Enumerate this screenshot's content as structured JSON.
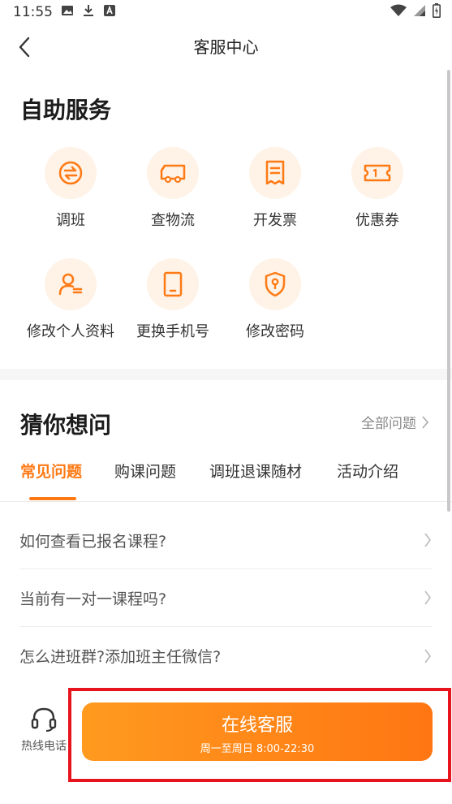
{
  "status_bar": {
    "time": "11:55"
  },
  "nav": {
    "title": "客服中心"
  },
  "self_service": {
    "title": "自助服务",
    "items": [
      {
        "label": "调班",
        "icon": "swap-icon"
      },
      {
        "label": "查物流",
        "icon": "truck-icon"
      },
      {
        "label": "开发票",
        "icon": "receipt-icon"
      },
      {
        "label": "优惠券",
        "icon": "coupon-icon"
      },
      {
        "label": "修改个人资料",
        "icon": "profile-edit-icon"
      },
      {
        "label": "更换手机号",
        "icon": "phone-icon"
      },
      {
        "label": "修改密码",
        "icon": "shield-lock-icon"
      }
    ]
  },
  "faq": {
    "title": "猜你想问",
    "see_all": "全部问题",
    "tabs": [
      {
        "label": "常见问题",
        "active": true
      },
      {
        "label": "购课问题",
        "active": false
      },
      {
        "label": "调班退课随材",
        "active": false
      },
      {
        "label": "活动介绍",
        "active": false
      }
    ],
    "questions": [
      "如何查看已报名课程?",
      "当前有一对一课程吗?",
      "怎么进班群?添加班主任微信?"
    ]
  },
  "bottom": {
    "hotline_label": "热线电话",
    "service_title": "在线客服",
    "service_hours": "周一至周日 8:00-22:30"
  },
  "colors": {
    "accent": "#ff7a14",
    "icon_bg": "#fff2e6",
    "highlight": "#e8141d"
  }
}
